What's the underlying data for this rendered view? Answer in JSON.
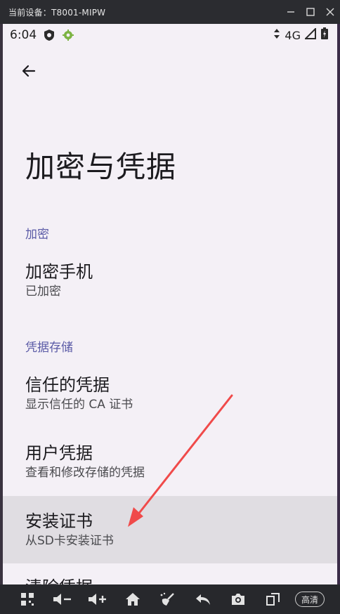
{
  "window": {
    "title": "当前设备：T8001-MIPW",
    "minimize_icon": "minimize-icon",
    "maximize_icon": "maximize-icon",
    "close_icon": "close-icon"
  },
  "statusbar": {
    "time": "6:04",
    "network": "4G"
  },
  "page": {
    "title": "加密与凭据"
  },
  "sections": [
    {
      "header": "加密"
    },
    {
      "header": "凭据存储"
    }
  ],
  "prefs": {
    "encrypt_phone": {
      "title": "加密手机",
      "summary": "已加密"
    },
    "trusted_credentials": {
      "title": "信任的凭据",
      "summary": "显示信任的 CA 证书"
    },
    "user_credentials": {
      "title": "用户凭据",
      "summary": "查看和修改存储的凭据"
    },
    "install_cert": {
      "title": "安装证书",
      "summary": "从SD卡安装证书"
    },
    "clear_credentials": {
      "title": "清除凭据"
    }
  },
  "toolbar": {
    "hd_label": "高清"
  },
  "colors": {
    "screen_bg": "#f4f0f6",
    "section_header": "#5a5aa6",
    "highlight_bg": "#e0dde2",
    "annotation_arrow": "#f04a4a"
  }
}
